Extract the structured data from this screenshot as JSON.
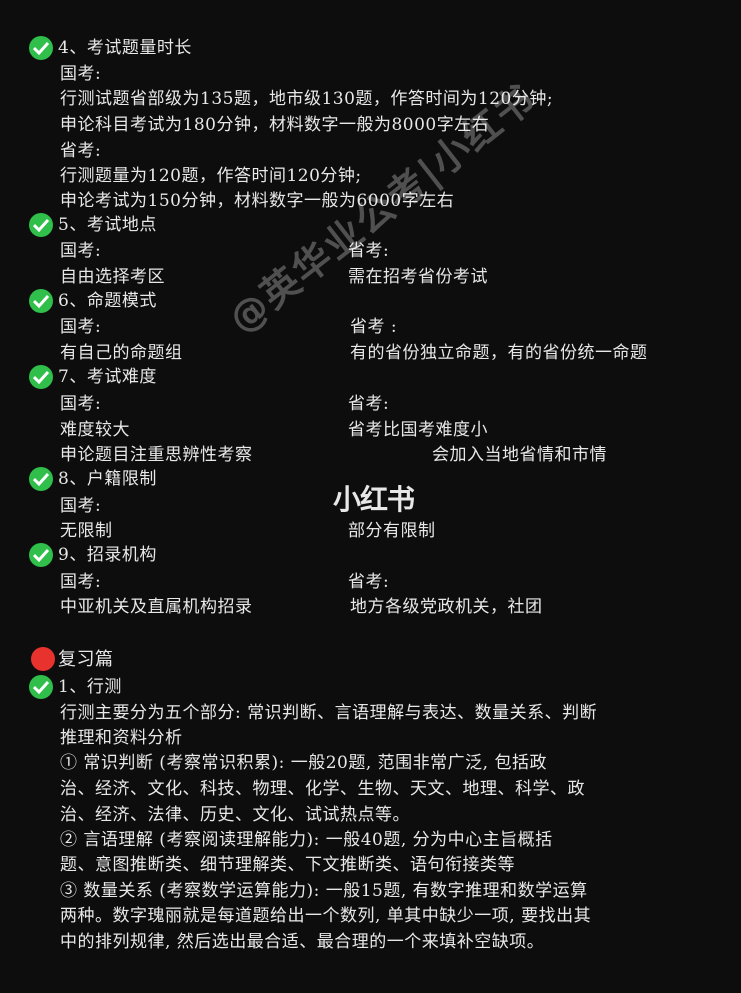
{
  "sections": {
    "s4": {
      "title": "4、考试题量时长",
      "lines": [
        "国考:",
        "行测试题省部级为135题，地市级130题，作答时间为120分钟;",
        "申论科目考试为180分钟，材料数字一般为8000字左右",
        "省考:",
        "行测题量为120题，作答时间120分钟;",
        "申论考试为150分钟，材料数字一般为6000字左右"
      ]
    },
    "s5": {
      "title": "5、考试地点",
      "left": [
        "国考:",
        "自由选择考区"
      ],
      "right": [
        "省考:",
        "需在招考省份考试"
      ]
    },
    "s6": {
      "title": "6、命题模式",
      "left": [
        "国考:",
        "有自己的命题组"
      ],
      "right": [
        "省考 :",
        "有的省份独立命题，有的省份统一命题"
      ]
    },
    "s7": {
      "title": "7、考试难度",
      "left": [
        "国考:",
        "难度较大",
        "申论题目注重思辨性考察"
      ],
      "right": [
        "省考:",
        "省考比国考难度小",
        "会加入当地省情和市情"
      ]
    },
    "s8": {
      "title": "8、户籍限制",
      "left": [
        "国考:",
        "无限制"
      ],
      "right": [
        "",
        "部分有限制"
      ]
    },
    "s9": {
      "title": "9、招录机构",
      "left": [
        "国考:",
        "中亚机关及直属机构招录"
      ],
      "right": [
        "省考:",
        "地方各级党政机关，社团"
      ]
    },
    "review": {
      "title": "复习篇",
      "sub": "1、行测",
      "lines": [
        "行测主要分为五个部分: 常识判断、言语理解与表达、数量关系、判断",
        "推理和资料分析",
        "① 常识判断 (考察常识积累): 一般20题, 范围非常广泛, 包括政",
        "治、经济、文化、科技、物理、化学、生物、天文、地理、科学、政",
        "治、经济、法律、历史、文化、试试热点等。",
        "② 言语理解 (考察阅读理解能力): 一般40题, 分为中心主旨概括",
        "题、意图推断类、细节理解类、下文推断类、语句衔接类等",
        "③ 数量关系 (考察数学运算能力): 一般15题, 有数字推理和数学运算",
        "两种。数字瑰丽就是每道题给出一个数列, 单其中缺少一项, 要找出其",
        "中的排列规律, 然后选出最合适、最合理的一个来填补空缺项。"
      ]
    }
  },
  "watermark": "@英华业公考|小红书",
  "logo": "小红书",
  "colors": {
    "background": "#0d0d0d",
    "text": "#e8e8e8",
    "check": "#2fbf4a",
    "red_dot": "#e8322e"
  },
  "icons": {
    "check": "check-circle-icon",
    "dot": "red-circle-icon"
  }
}
